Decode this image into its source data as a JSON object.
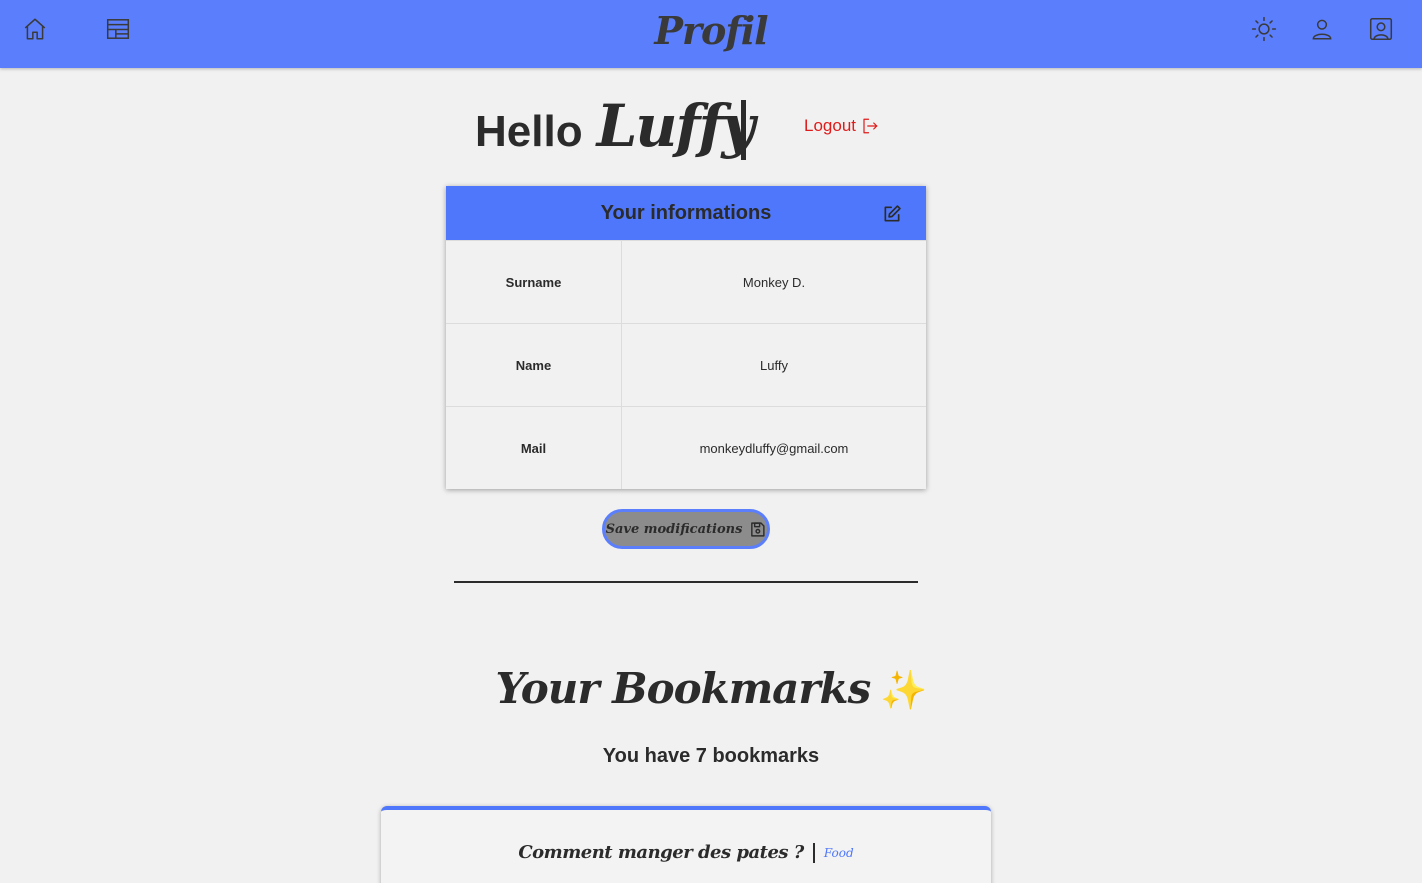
{
  "header": {
    "brand": "Profil",
    "left_icons": [
      "home-icon",
      "calendar-icon"
    ],
    "right_icons": [
      "sun-icon",
      "user-icon",
      "user-square-icon"
    ]
  },
  "greeting": {
    "hello": "Hello",
    "name": "Luffy",
    "logout_label": "Logout"
  },
  "info_card": {
    "title": "Your informations",
    "rows": [
      {
        "label": "Surname",
        "value": "Monkey D."
      },
      {
        "label": "Name",
        "value": "Luffy"
      },
      {
        "label": "Mail",
        "value": "monkeydluffy@gmail.com"
      }
    ]
  },
  "save_button": {
    "label": "Save modifications"
  },
  "bookmarks": {
    "title": "Your Bookmarks",
    "emoji": "✨",
    "count_text": "You have 7 bookmarks",
    "items": [
      {
        "title": "Comment manger des pates ?",
        "tag": "Food"
      }
    ]
  },
  "colors": {
    "accent": "#5b7ffc",
    "header_card": "#4f77fb",
    "logout": "#e01b1b",
    "background": "#f1f1f1"
  }
}
